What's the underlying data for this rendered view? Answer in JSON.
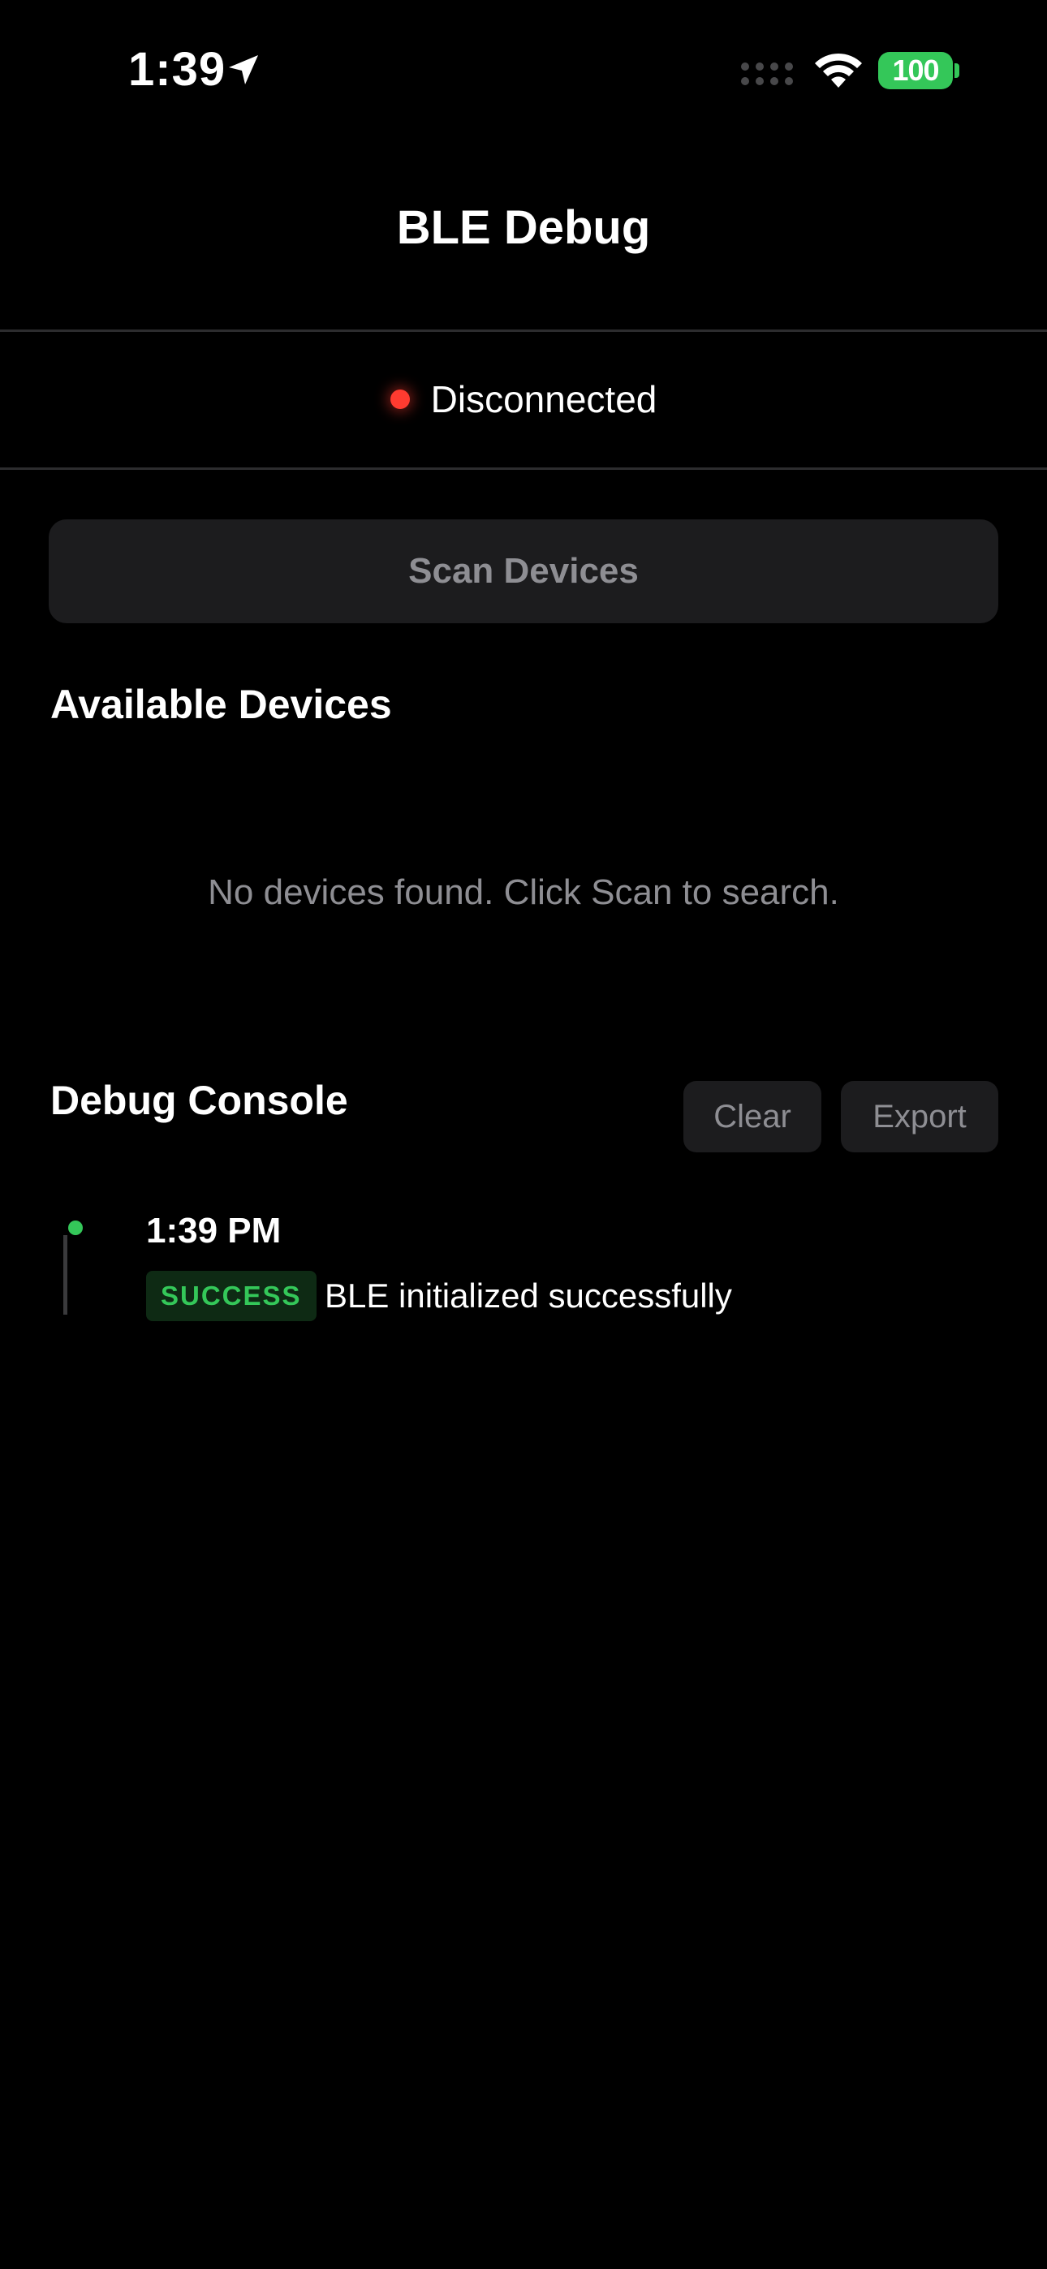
{
  "status_bar": {
    "time": "1:39",
    "battery": "100"
  },
  "header": {
    "title": "BLE Debug"
  },
  "connection": {
    "status": "Disconnected",
    "dot_color": "#ff3b30"
  },
  "scan": {
    "label": "Scan Devices"
  },
  "devices": {
    "title": "Available Devices",
    "empty_text": "No devices found. Click Scan to search."
  },
  "console": {
    "title": "Debug Console",
    "clear_label": "Clear",
    "export_label": "Export",
    "entries": [
      {
        "time": "1:39 PM",
        "level": "SUCCESS",
        "message": "BLE initialized successfully",
        "level_color": "#34c759"
      }
    ]
  },
  "colors": {
    "background": "#000000",
    "surface": "#1c1c1e",
    "muted_text": "#8e8e93",
    "success": "#34c759",
    "error": "#ff3b30"
  }
}
